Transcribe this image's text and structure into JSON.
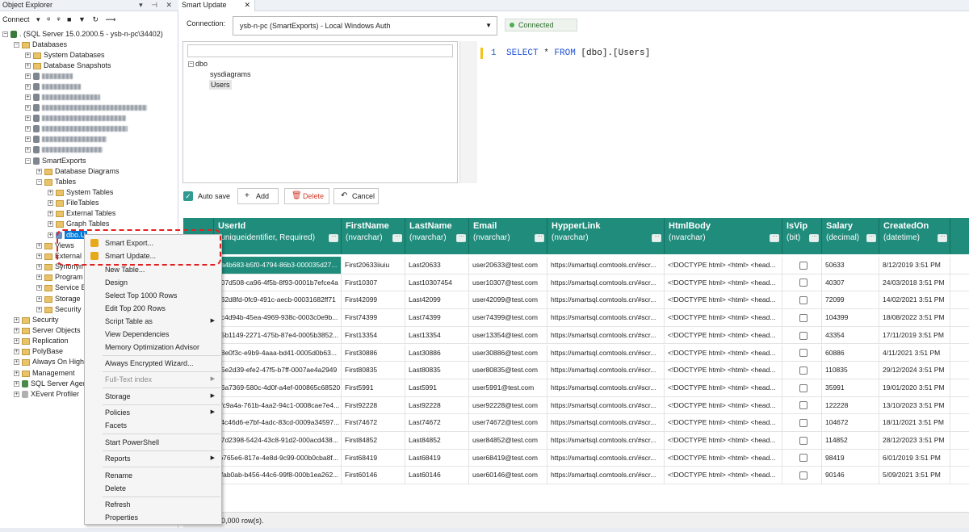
{
  "object_explorer": {
    "title": "Object Explorer",
    "toolbar": {
      "connect_label": "Connect"
    },
    "server": ". (SQL Server 15.0.2000.5 - ysb-n-pc\\34402)",
    "nodes": {
      "databases": "Databases",
      "system_databases": "System Databases",
      "database_snapshots": "Database Snapshots",
      "smartexports": "SmartExports",
      "database_diagrams": "Database Diagrams",
      "tables": "Tables",
      "system_tables": "System Tables",
      "filetables": "FileTables",
      "external_tables": "External Tables",
      "graph_tables": "Graph Tables",
      "dbo_users": "dbo.U",
      "views": "Views",
      "external_resources": "External R",
      "synonyms": "Synonym",
      "programmability": "Program",
      "service_broker": "Service B",
      "storage": "Storage",
      "security_sub": "Security",
      "security": "Security",
      "server_objects": "Server Objects",
      "replication": "Replication",
      "polybase": "PolyBase",
      "always_on": "Always On High",
      "management": "Management",
      "sql_agent": "SQL Server Agen",
      "xevent": "XEvent Profiler"
    }
  },
  "context_menu": {
    "smart_export": "Smart Export...",
    "smart_update": "Smart Update...",
    "new_table": "New Table...",
    "design": "Design",
    "select_top": "Select Top 1000 Rows",
    "edit_top": "Edit Top 200 Rows",
    "script_table": "Script Table as",
    "view_dependencies": "View Dependencies",
    "memory_optimization": "Memory Optimization Advisor",
    "always_encrypted": "Always Encrypted Wizard...",
    "fulltext_index": "Full-Text index",
    "storage": "Storage",
    "policies": "Policies",
    "facets": "Facets",
    "start_powershell": "Start PowerShell",
    "reports": "Reports",
    "rename": "Rename",
    "delete": "Delete",
    "refresh": "Refresh",
    "properties": "Properties"
  },
  "tab": {
    "title": "Smart Update"
  },
  "connection": {
    "label": "Connection:",
    "value": "ysb-n-pc (SmartExports) - Local Windows Auth",
    "status": "Connected"
  },
  "schema_tree": {
    "schema": "dbo",
    "items": [
      "sysdiagrams",
      "Users"
    ]
  },
  "editor": {
    "line_number": "1",
    "kw1": "SELECT",
    "rest1": " * ",
    "kw2": "FROM",
    "rest2": " [dbo].[Users]"
  },
  "actions": {
    "autosave": "Auto save",
    "add": "Add",
    "delete": "Delete",
    "cancel": "Cancel"
  },
  "grid": {
    "columns": [
      {
        "name": "UserId",
        "type": "(uniqueidentifier, Required)"
      },
      {
        "name": "FirstName",
        "type": "(nvarchar)"
      },
      {
        "name": "LastName",
        "type": "(nvarchar)"
      },
      {
        "name": "Email",
        "type": "(nvarchar)"
      },
      {
        "name": "HypperLink",
        "type": "(nvarchar)"
      },
      {
        "name": "HtmlBody",
        "type": "(nvarchar)"
      },
      {
        "name": "IsVip",
        "type": "(bit)"
      },
      {
        "name": "Salary",
        "type": "(decimal)"
      },
      {
        "name": "CreatedOn",
        "type": "(datetime)"
      }
    ],
    "rows": [
      [
        "3a4b683-b5f0-4794-86b3-000035d27...",
        "First20633iiuiu",
        "Last20633",
        "user20633@test.com",
        "https://smartsql.comtools.cn/#scr...",
        "<!DOCTYPE html> <html> <head...",
        "50633",
        "8/12/2019 3:51 PM"
      ],
      [
        "207d508-ca96-4f5b-8f93-0001b7efce4a",
        "First10307",
        "Last10307454",
        "user10307@test.com",
        "https://smartsql.comtools.cn/#scr...",
        "<!DOCTYPE html> <html> <head...",
        "40307",
        "24/03/2018 3:51 PM"
      ],
      [
        "962d8fd-0fc9-491c-aecb-00031682ff71",
        "First42099",
        "Last42099",
        "user42099@test.com",
        "https://smartsql.comtools.cn/#scr...",
        "<!DOCTYPE html> <html> <head...",
        "72099",
        "14/02/2021 3:51 PM"
      ],
      [
        "6c4d94b-45ea-4969-938c-0003c0e9b...",
        "First74399",
        "Last74399",
        "user74399@test.com",
        "https://smartsql.comtools.cn/#scr...",
        "<!DOCTYPE html> <html> <head...",
        "104399",
        "18/08/2022 3:51 PM"
      ],
      [
        "85b1149-2271-475b-87e4-0005b3852...",
        "First13354",
        "Last13354",
        "user13354@test.com",
        "https://smartsql.comtools.cn/#scr...",
        "<!DOCTYPE html> <html> <head...",
        "43354",
        "17/11/2019 3:51 PM"
      ],
      [
        "68e0f3c-e9b9-4aaa-bd41-0005d0b63...",
        "First30886",
        "Last30886",
        "user30886@test.com",
        "https://smartsql.comtools.cn/#scr...",
        "<!DOCTYPE html> <html> <head...",
        "60886",
        "4/11/2021 3:51 PM"
      ],
      [
        "15e2d39-efe2-47f5-b7ff-0007ae4a2949",
        "First80835",
        "Last80835",
        "user80835@test.com",
        "https://smartsql.comtools.cn/#scr...",
        "<!DOCTYPE html> <html> <head...",
        "110835",
        "29/12/2024 3:51 PM"
      ],
      [
        "36a7369-580c-4d0f-a4ef-000865c68520",
        "First5991",
        "Last5991",
        "user5991@test.com",
        "https://smartsql.comtools.cn/#scr...",
        "<!DOCTYPE html> <html> <head...",
        "35991",
        "19/01/2020 3:51 PM"
      ],
      [
        "cfc9a4a-761b-4aa2-94c1-0008cae7e4...",
        "First92228",
        "Last92228",
        "user92228@test.com",
        "https://smartsql.comtools.cn/#scr...",
        "<!DOCTYPE html> <html> <head...",
        "122228",
        "13/10/2023 3:51 PM"
      ],
      [
        "c4c46d6-e7bf-4adc-83cd-0009a34597...",
        "First74672",
        "Last74672",
        "user74672@test.com",
        "https://smartsql.comtools.cn/#scr...",
        "<!DOCTYPE html> <html> <head...",
        "104672",
        "18/11/2021 3:51 PM"
      ],
      [
        "47d2398-5424-43c8-91d2-000acd438...",
        "First84852",
        "Last84852",
        "user84852@test.com",
        "https://smartsql.comtools.cn/#scr...",
        "<!DOCTYPE html> <html> <head...",
        "114852",
        "28/12/2023 3:51 PM"
      ],
      [
        "fb765e6-817e-4e8d-9c99-000b0cba8f...",
        "First68419",
        "Last68419",
        "user68419@test.com",
        "https://smartsql.comtools.cn/#scr...",
        "<!DOCTYPE html> <html> <head...",
        "98419",
        "6/01/2019 3:51 PM"
      ],
      [
        "1fab0ab-b456-44c6-99f8-000b1ea262...",
        "First60146",
        "Last60146",
        "user60146@test.com",
        "https://smartsql.comtools.cn/#scr...",
        "<!DOCTYPE html> <html> <head...",
        "90146",
        "5/09/2021 3:51 PM"
      ]
    ],
    "footer": "0,000 row(s)."
  },
  "colors": {
    "accent": "#1f8c7c",
    "selection": "#0078d7",
    "highlight_dash": "#e32020"
  }
}
